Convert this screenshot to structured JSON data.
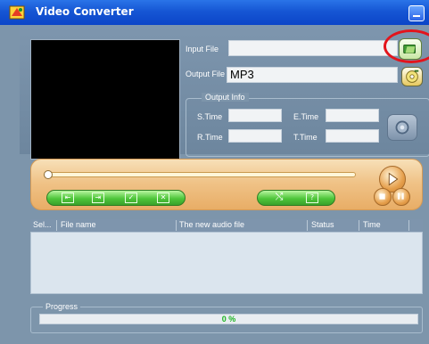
{
  "window": {
    "title": "Video Converter"
  },
  "input": {
    "label": "Input File",
    "value": ""
  },
  "output": {
    "label": "Output File",
    "value": "MP3"
  },
  "output_info": {
    "legend": "Output Info",
    "s_time_label": "S.Time",
    "e_time_label": "E.Time",
    "r_time_label": "R.Time",
    "t_time_label": "T.Time"
  },
  "playback": {
    "position_fraction": 0.0
  },
  "list": {
    "columns": [
      "Sel...",
      "File name",
      "The new audio file",
      "Status",
      "Time"
    ],
    "rows": []
  },
  "progress": {
    "legend": "Progress",
    "text": "0 %",
    "value": 0
  },
  "colors": {
    "titlebar": "#0b45c8",
    "panel": "#7d95ab",
    "accent_green": "#38c12a",
    "highlight_ring": "#e3141c"
  }
}
